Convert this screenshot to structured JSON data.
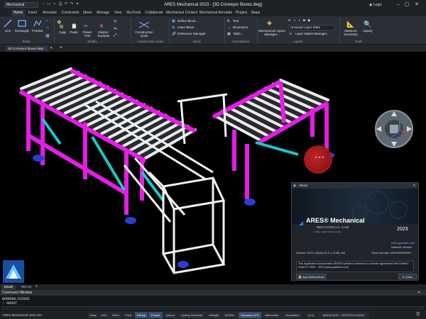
{
  "titlebar": {
    "workspace": "Mechanical",
    "title": "ARES Mechanical 2023 - [3D Conveyor Boxes.dwg]",
    "login": "Login"
  },
  "menu": {
    "tabs": [
      "Home",
      "Insert",
      "Annotate",
      "Constraints",
      "Sheet",
      "Manage",
      "View",
      "XtraTools",
      "Collaborate",
      "Mechanical Content",
      "Mechanical Annotate",
      "Plugins",
      "Maps"
    ]
  },
  "ribbon": {
    "draw": {
      "line": "Line",
      "rectangle": "Rectangle",
      "polyline": "Polyline",
      "label": "Draw"
    },
    "modify": {
      "copy": "Copy",
      "paste": "Paste",
      "power_trim": "Power\nTrim",
      "delete": "Delete /\nExplode",
      "label": "Modify"
    },
    "construction": {
      "button": "Construction\nLines",
      "label": "Construction Lines"
    },
    "insert": {
      "define_block": "Define Block...",
      "insert_block": "Insert Block",
      "reference_manager": "Reference Manager",
      "label": "Insert"
    },
    "annotations": {
      "text": "Text",
      "dimension": "Dimension",
      "table": "Table...",
      "label": "Annotations"
    },
    "layers": {
      "mech_layers": "Mechanical Layers\nManager...",
      "current_layer": "Unsaved Layer State",
      "layer_states": "Layer States Manager...",
      "label": "Layers"
    },
    "tools": {
      "measure": "Measure\nGeometry",
      "inquiry": "Inquiry",
      "label": "Tools"
    }
  },
  "document": {
    "tab": "3D Conveyor Boxes.dwg*"
  },
  "model_tabs": [
    "Model",
    "ISO A4"
  ],
  "command": {
    "title": "Command Window",
    "lines": [
      "BORROWLICENSE",
      ": ABOUT"
    ]
  },
  "status": {
    "app": "ARES Mechanical 2023 x64",
    "buttons": [
      "Snap",
      "Grid",
      "Ortho",
      "Polar",
      "ESnap",
      "ETrack",
      "QInput",
      "Cycling Selection",
      "LWeight",
      "MODEL",
      "Dynamic CCS",
      "AMmonitor",
      "Annotation",
      "(1:1)",
      "(68153.8437, -20370763.0.0000)"
    ]
  },
  "about": {
    "title": "About",
    "brand": "ARES® Mechanical",
    "subtitle": "MECHANICAL CAD",
    "version_year": "2023",
    "copyright_small": "© 2004 - 2022 Gräbert GmbH",
    "website": "www.graebert.com",
    "network_version": "Network Version",
    "version_line": "Version 2023.2 (Build 23.2.1.3138) x64",
    "serial_line": "Serial Number 9999999999999",
    "notice": "This application incorporates ARES® software pursuant to a license agreement with Gräbert GmbH © 2004 - 2022 (www.graebert.com)",
    "app_notifications": "App Notifications",
    "close": "Close"
  },
  "colors": {
    "accent": "#2d7fd3",
    "frame": "#e51de6",
    "cyan": "#18c8c8",
    "roller": "#e8ecf0"
  }
}
